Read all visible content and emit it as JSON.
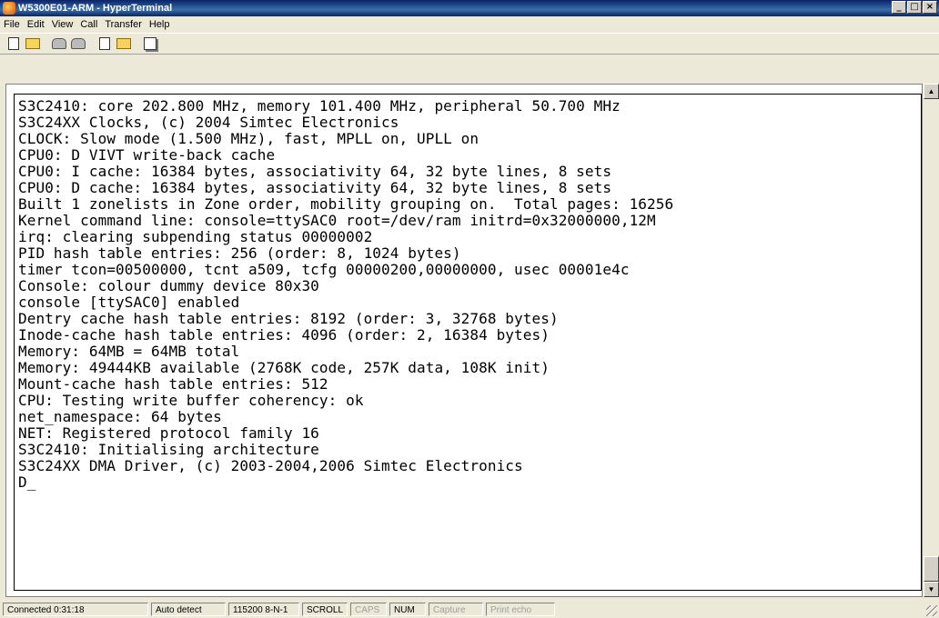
{
  "window": {
    "title": "W5300E01-ARM - HyperTerminal"
  },
  "menu": [
    "File",
    "Edit",
    "View",
    "Call",
    "Transfer",
    "Help"
  ],
  "toolbar": {
    "icons": [
      "new-document-icon",
      "open-folder-icon",
      "connect-icon",
      "disconnect-icon",
      "send-icon",
      "receive-icon",
      "properties-icon"
    ]
  },
  "terminal": {
    "lines": [
      "S3C2410: core 202.800 MHz, memory 101.400 MHz, peripheral 50.700 MHz",
      "S3C24XX Clocks, (c) 2004 Simtec Electronics",
      "CLOCK: Slow mode (1.500 MHz), fast, MPLL on, UPLL on",
      "CPU0: D VIVT write-back cache",
      "CPU0: I cache: 16384 bytes, associativity 64, 32 byte lines, 8 sets",
      "CPU0: D cache: 16384 bytes, associativity 64, 32 byte lines, 8 sets",
      "Built 1 zonelists in Zone order, mobility grouping on.  Total pages: 16256",
      "Kernel command line: console=ttySAC0 root=/dev/ram initrd=0x32000000,12M",
      "irq: clearing subpending status 00000002",
      "PID hash table entries: 256 (order: 8, 1024 bytes)",
      "timer tcon=00500000, tcnt a509, tcfg 00000200,00000000, usec 00001e4c",
      "Console: colour dummy device 80x30",
      "console [ttySAC0] enabled",
      "Dentry cache hash table entries: 8192 (order: 3, 32768 bytes)",
      "Inode-cache hash table entries: 4096 (order: 2, 16384 bytes)",
      "Memory: 64MB = 64MB total",
      "Memory: 49444KB available (2768K code, 257K data, 108K init)",
      "Mount-cache hash table entries: 512",
      "CPU: Testing write buffer coherency: ok",
      "net_namespace: 64 bytes",
      "NET: Registered protocol family 16",
      "S3C2410: Initialising architecture",
      "S3C24XX DMA Driver, (c) 2003-2004,2006 Simtec Electronics",
      "D_"
    ]
  },
  "status": {
    "connected": "Connected 0:31:18",
    "detect": "Auto detect",
    "settings": "115200 8-N-1",
    "scroll": "SCROLL",
    "caps": "CAPS",
    "num": "NUM",
    "capture": "Capture",
    "print_echo": "Print echo"
  }
}
